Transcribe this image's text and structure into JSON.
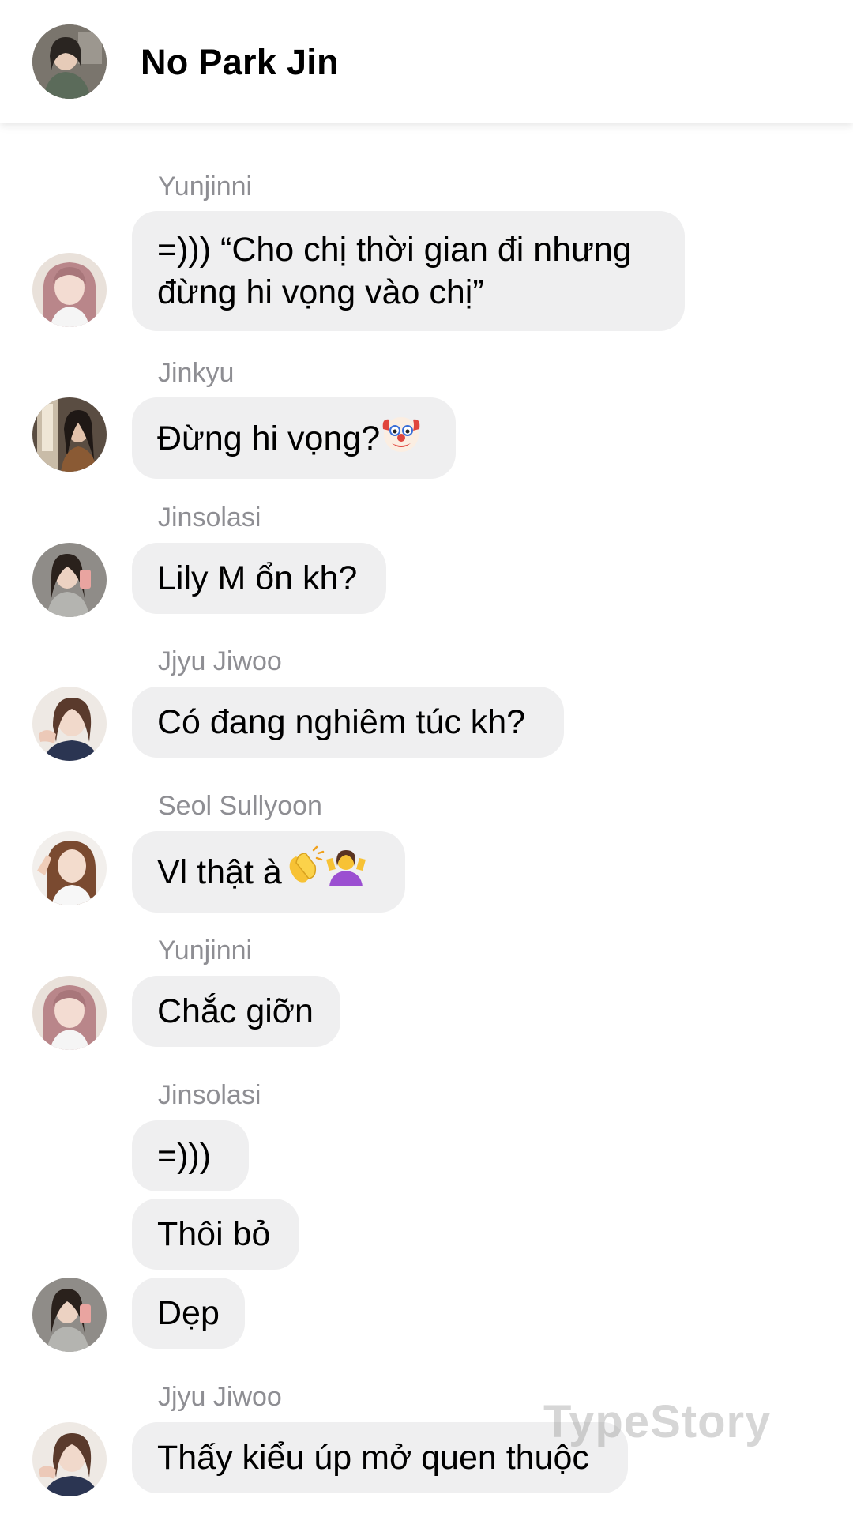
{
  "header": {
    "title": "No Park Jin",
    "avatar_icon": "profile-photo"
  },
  "messages": [
    {
      "sender": "Yunjinni",
      "texts": [
        "=))) “Cho chị thời gian đi nhưng đừng hi vọng vào chị”"
      ]
    },
    {
      "sender": "Jinkyu",
      "texts": [
        "Đừng hi vọng?"
      ],
      "emoji": [
        "clown-face-icon"
      ]
    },
    {
      "sender": "Jinsolasi",
      "texts": [
        "Lily M ổn kh?"
      ]
    },
    {
      "sender": "Jjyu Jiwoo",
      "texts": [
        "Có đang nghiêm túc kh?"
      ]
    },
    {
      "sender": "Seol Sullyoon",
      "texts": [
        "Vl thật à"
      ],
      "emoji": [
        "clapping-hands-icon",
        "person-shrugging-icon"
      ]
    },
    {
      "sender": "Yunjinni",
      "texts": [
        "Chắc giỡn"
      ]
    },
    {
      "sender": "Jinsolasi",
      "texts": [
        "=)))",
        "Thôi bỏ",
        "Dẹp"
      ]
    },
    {
      "sender": "Jjyu Jiwoo",
      "texts": [
        "Thấy kiểu úp mở quen thuộc"
      ]
    }
  ],
  "watermark": "TypeStory",
  "colors": {
    "bubble": "#efeff0",
    "sender": "#8e8e93",
    "text": "#000000"
  }
}
